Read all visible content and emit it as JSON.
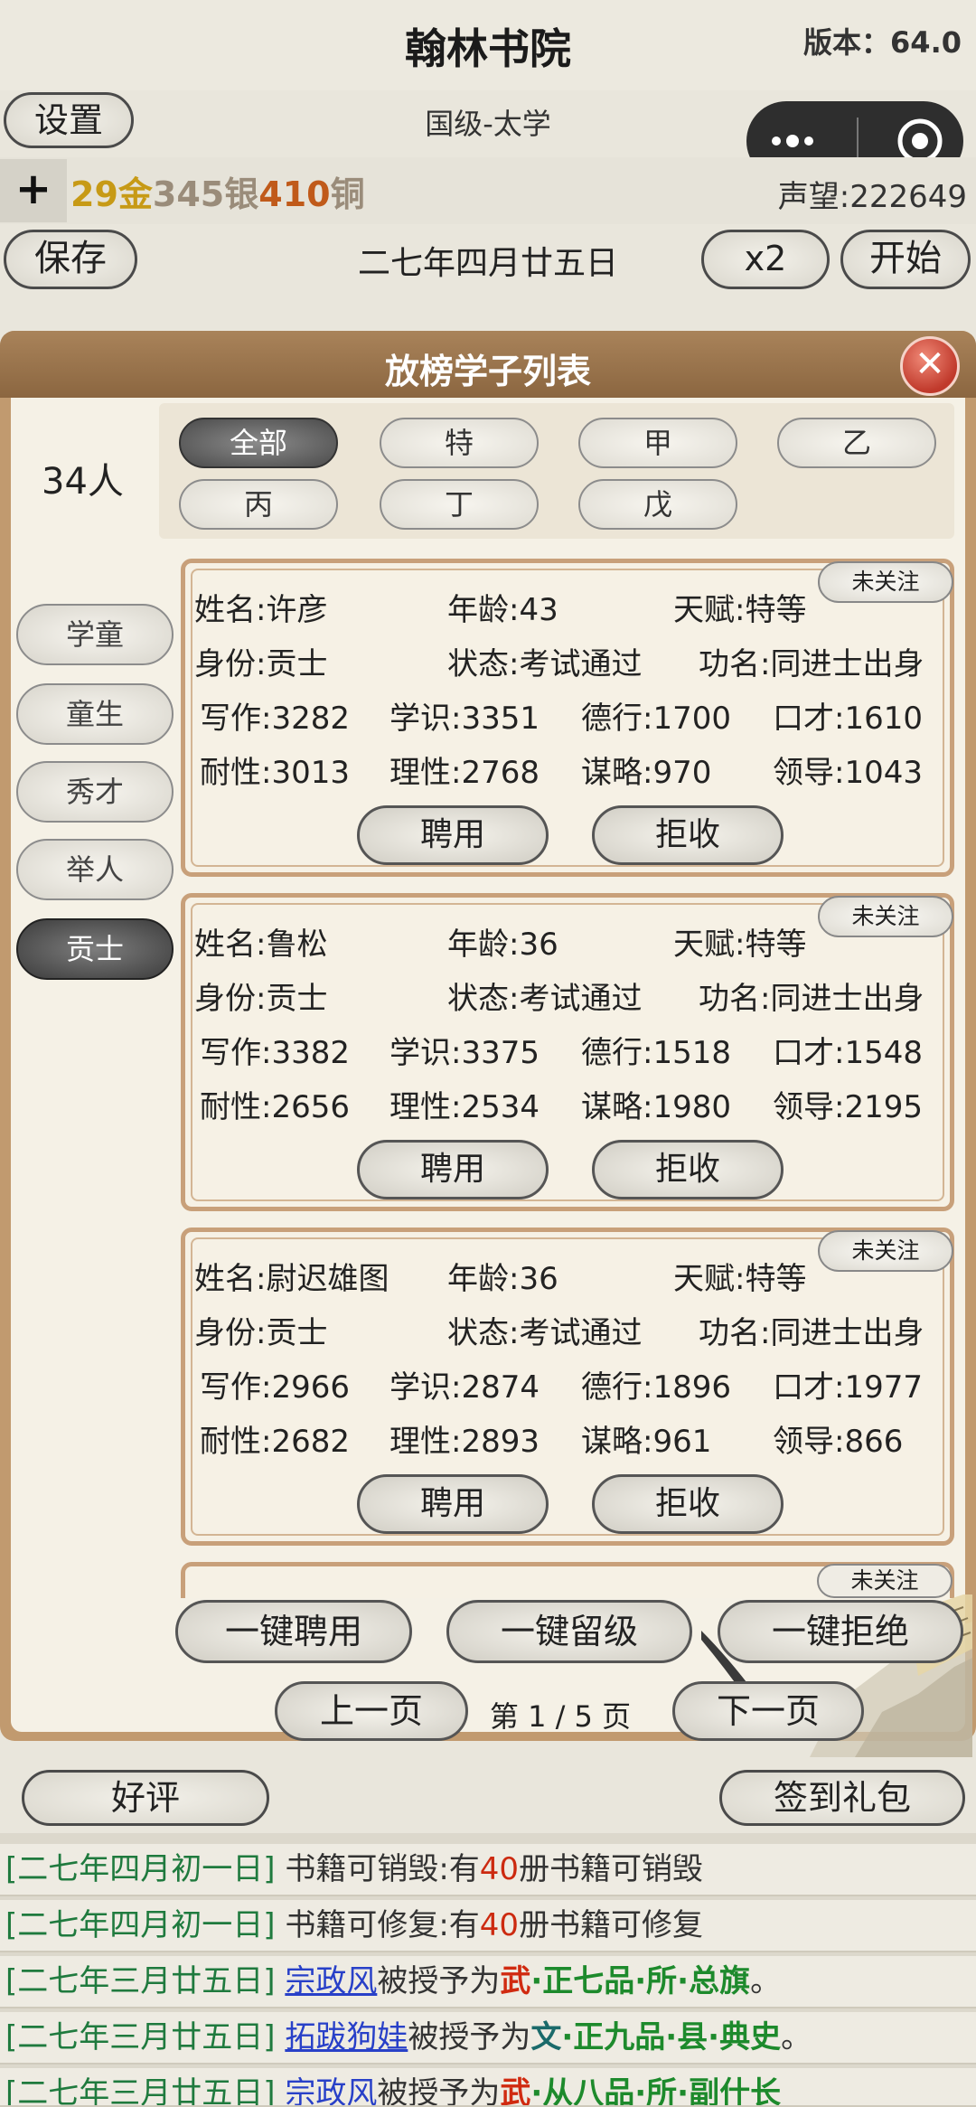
{
  "header": {
    "title": "翰林书院",
    "version": "版本：64.0",
    "settings_label": "设置",
    "level": "国级-太学",
    "plus": "+",
    "gold": "29",
    "gold_unit": "金",
    "silver": "345",
    "silver_unit": "银",
    "copper": "410",
    "copper_unit": "铜",
    "prestige": "声望:222649",
    "save_label": "保存",
    "date": "二七年四月廿五日",
    "speed_label": "x2",
    "start_label": "开始"
  },
  "modal": {
    "title": "放榜学子列表",
    "close": "✕",
    "count": "34人",
    "filters": [
      "全部",
      "特",
      "甲",
      "乙",
      "丙",
      "丁",
      "戊"
    ],
    "active_filter": 0,
    "ranks": [
      "学童",
      "童生",
      "秀才",
      "举人",
      "贡士"
    ],
    "active_rank": 4,
    "students": [
      {
        "name": "姓名:许彦",
        "age": "年龄:43",
        "talent": "天赋:特等",
        "follow": "未关注",
        "identity": "身份:贡士",
        "status": "状态:考试通过",
        "title": "功名:同进士出身",
        "writing": "写作:3282",
        "knowledge": "学识:3351",
        "virtue": "德行:1700",
        "eloquence": "口才:1610",
        "patience": "耐性:3013",
        "reason": "理性:2768",
        "strategy": "谋略:970",
        "leadership": "领导:1043",
        "hire": "聘用",
        "reject": "拒收"
      },
      {
        "name": "姓名:鲁松",
        "age": "年龄:36",
        "talent": "天赋:特等",
        "follow": "未关注",
        "identity": "身份:贡士",
        "status": "状态:考试通过",
        "title": "功名:同进士出身",
        "writing": "写作:3382",
        "knowledge": "学识:3375",
        "virtue": "德行:1518",
        "eloquence": "口才:1548",
        "patience": "耐性:2656",
        "reason": "理性:2534",
        "strategy": "谋略:1980",
        "leadership": "领导:2195",
        "hire": "聘用",
        "reject": "拒收"
      },
      {
        "name": "姓名:尉迟雄图",
        "age": "年龄:36",
        "talent": "天赋:特等",
        "follow": "未关注",
        "identity": "身份:贡士",
        "status": "状态:考试通过",
        "title": "功名:同进士出身",
        "writing": "写作:2966",
        "knowledge": "学识:2874",
        "virtue": "德行:1896",
        "eloquence": "口才:1977",
        "patience": "耐性:2682",
        "reason": "理性:2893",
        "strategy": "谋略:961",
        "leadership": "领导:866",
        "hire": "聘用",
        "reject": "拒收"
      }
    ],
    "peek_follow": "未关注",
    "bulk_hire": "一键聘用",
    "bulk_hold": "一键留级",
    "bulk_reject": "一键拒绝",
    "prev_page": "上一页",
    "page_info": "第 1 / 5 页",
    "next_page": "下一页"
  },
  "footer": {
    "praise": "好评",
    "checkin": "签到礼包"
  },
  "log": [
    {
      "date": "[二七年四月初一日]",
      "pre": " 书籍可销毁:有",
      "num": "40",
      "post": "册书籍可销毁"
    },
    {
      "date": "[二七年四月初一日]",
      "pre": " 书籍可修复:有",
      "num": "40",
      "post": "册书籍可修复"
    },
    {
      "date": "[二七年三月廿五日]",
      "who": "宗政风",
      "mid": "被授予为",
      "a": "武",
      "b": "·正七品·所·总旗",
      "end": "。"
    },
    {
      "date": "[二七年三月廿五日]",
      "who": "拓跋狗娃",
      "mid": "被授予为",
      "a": "文",
      "b": "·正九品·县·典史",
      "end": "。"
    },
    {
      "date": "[二七年三月廿五日]",
      "who": "宗政风",
      "mid": "被授予为",
      "a": "武",
      "b": "·从八品·所·副什长"
    }
  ]
}
